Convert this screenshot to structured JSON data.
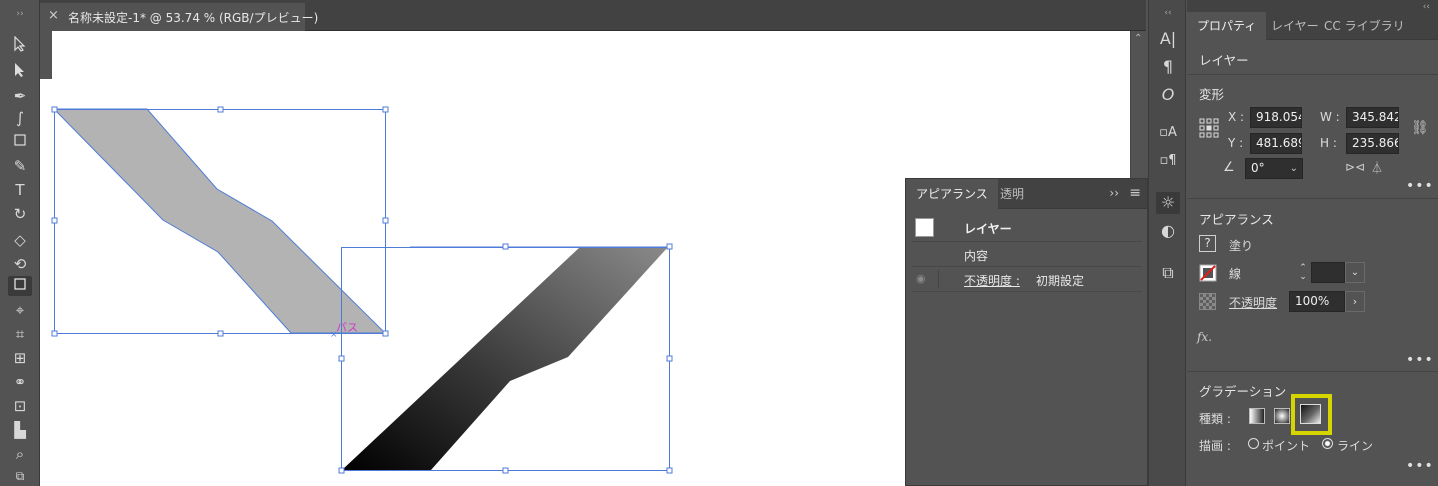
{
  "document_tab": {
    "close": "×",
    "title": "名称未設定-1* @ 53.74 % (RGB/プレビュー)"
  },
  "canvas": {
    "path_label": "パス"
  },
  "appearance_panel": {
    "tabs": [
      "アピアランス",
      "透明"
    ],
    "collapse": "››",
    "menu": "≡",
    "rows": {
      "layer": "レイヤー",
      "contents": "内容",
      "opacity_label": "不透明度 :",
      "opacity_value": "初期設定"
    }
  },
  "properties": {
    "tabs": [
      "プロパティ",
      "レイヤー",
      "CC ライブラリ"
    ],
    "layer_heading": "レイヤー",
    "transform": {
      "title": "変形",
      "x_label": "X :",
      "x_value": "918.054",
      "y_label": "Y :",
      "y_value": "481.689",
      "w_label": "W :",
      "w_value": "345.842",
      "h_label": "H :",
      "h_value": "235.866",
      "angle_value": "0°"
    },
    "appearance": {
      "title": "アピアランス",
      "fill_label": "塗り",
      "stroke_label": "線",
      "opacity_label": "不透明度",
      "opacity_value": "100%",
      "fx": "fx."
    },
    "gradient": {
      "title": "グラデーション",
      "type_label": "種類 :",
      "draw_label": "描画 :",
      "point_option": "ポイント",
      "line_option": "ライン",
      "selected_draw": "ライン"
    },
    "more": "•••"
  },
  "colors": {
    "selection": "#4f7bd8",
    "highlight": "#d7d500",
    "path_label": "#d23ccc"
  }
}
